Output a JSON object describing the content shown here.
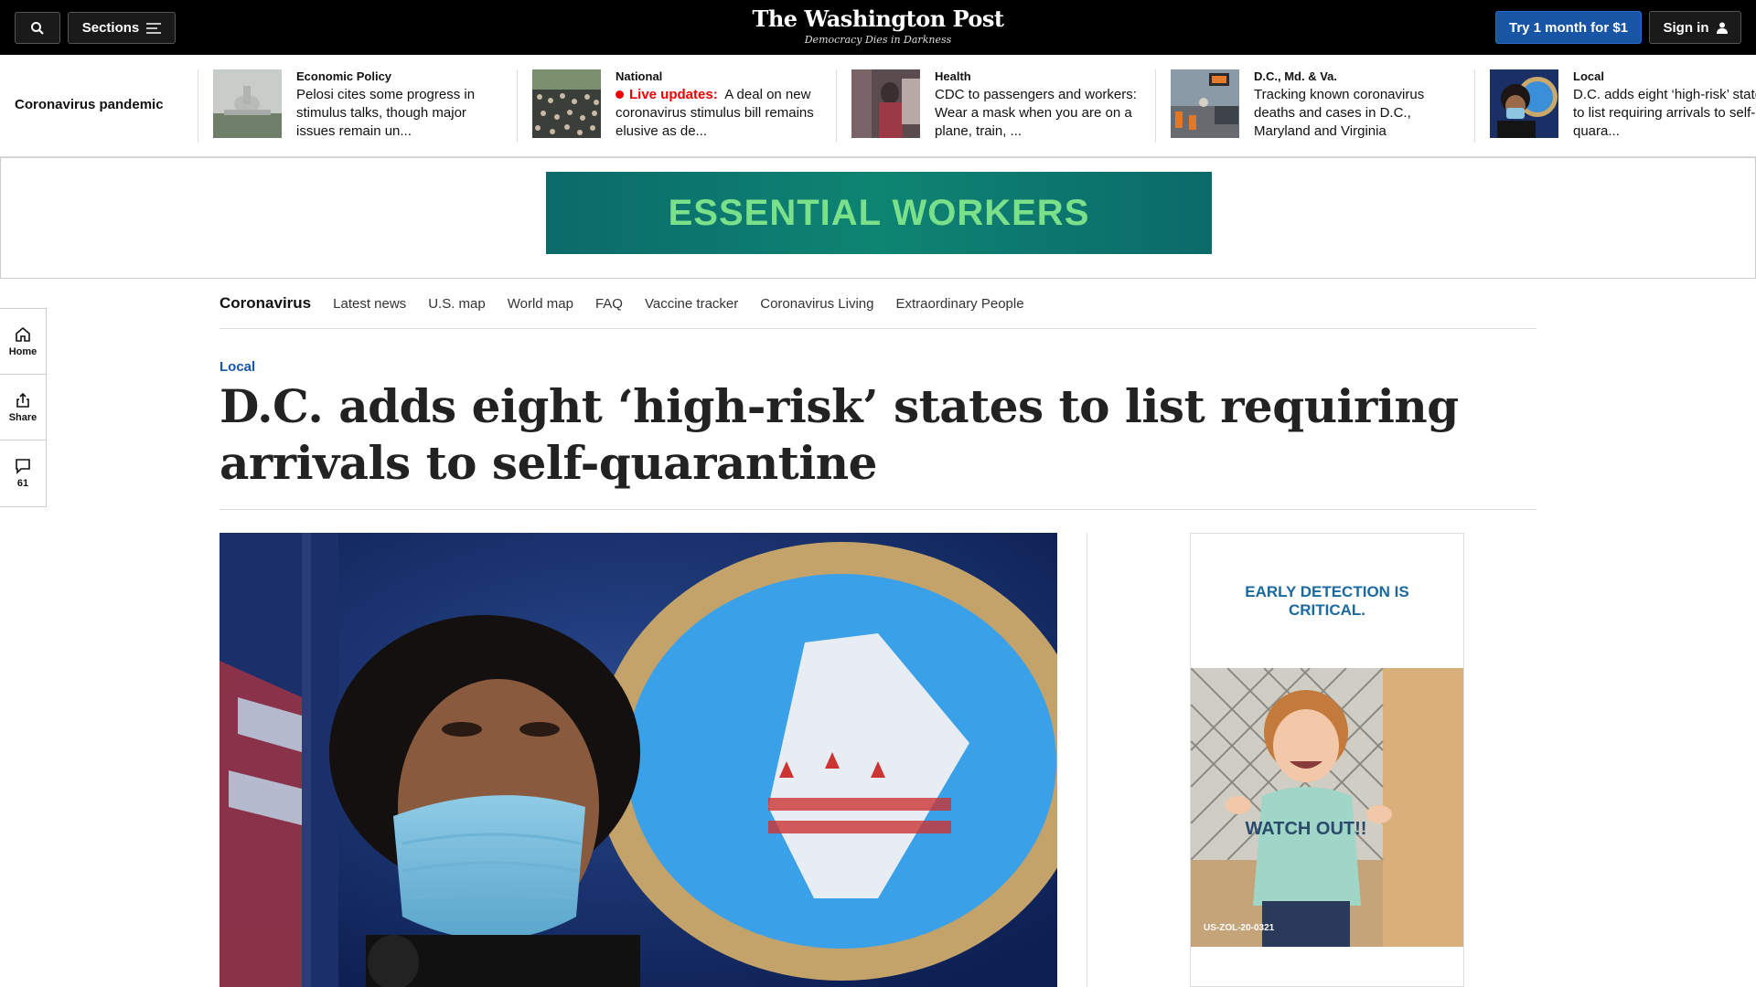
{
  "header": {
    "sections_label": "Sections",
    "logo": "The Washington Post",
    "tagline": "Democracy Dies in Darkness",
    "trial_label": "Try 1 month for $1",
    "signin_label": "Sign in"
  },
  "strip": {
    "label": "Coronavirus pandemic",
    "items": [
      {
        "kicker": "Economic Policy",
        "headline": "Pelosi cites some progress in stimulus talks, though major issues remain un..."
      },
      {
        "kicker": "National",
        "live": "Live updates:",
        "headline": "A deal on new coronavirus stimulus bill remains elusive as de..."
      },
      {
        "kicker": "Health",
        "headline": "CDC to passengers and workers: Wear a mask when you are on a plane, train, ..."
      },
      {
        "kicker": "D.C., Md. & Va.",
        "headline": "Tracking known coronavirus deaths and cases in D.C., Maryland and Virginia"
      },
      {
        "kicker": "Local",
        "headline": "D.C. adds eight ‘high-risk’ states to list requiring arrivals to self-quara..."
      }
    ]
  },
  "ad_banner": {
    "text": "ESSENTIAL WORKERS",
    "color": "#0e8472"
  },
  "subnav": {
    "title": "Coronavirus",
    "links": [
      "Latest news",
      "U.S. map",
      "World map",
      "FAQ",
      "Vaccine tracker",
      "Coronavirus Living",
      "Extraordinary People"
    ]
  },
  "rail": {
    "home": "Home",
    "share": "Share",
    "comments": "61"
  },
  "article": {
    "section": "Local",
    "title": "D.C. adds eight ‘high-risk’ states to list requiring arrivals to self-quarantine"
  },
  "side_ad": {
    "headline": "EARLY DETECTION IS CRITICAL.",
    "shirt_text": "WATCH OUT!!",
    "code": "US-ZOL-20-0321"
  }
}
